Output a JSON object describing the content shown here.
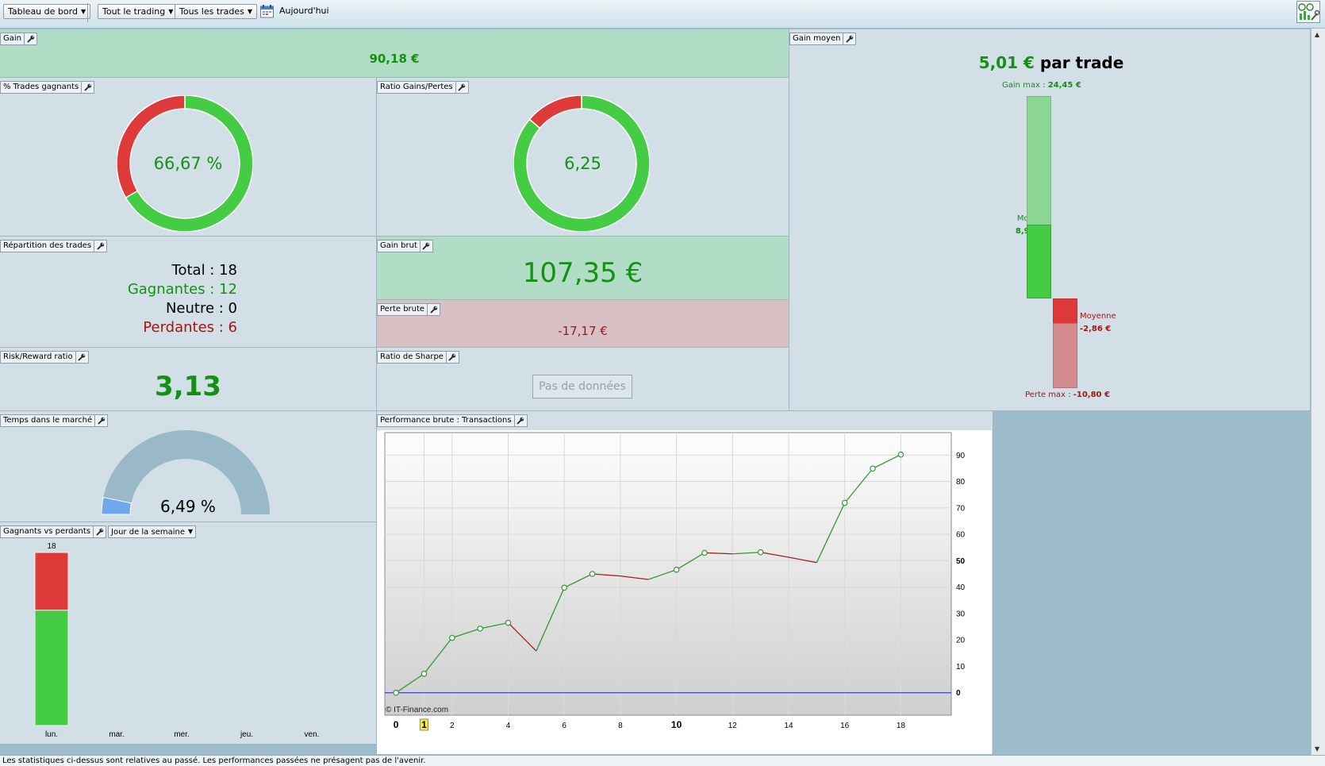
{
  "toolbar": {
    "dashboard_label": "Tableau de bord",
    "trading_filter_label": "Tout le trading",
    "trades_filter_label": "Tous les trades",
    "date_label": "Aujourd'hui"
  },
  "gain": {
    "title": "Gain",
    "value": "90,18 €"
  },
  "win_rate": {
    "title": "% Trades gagnants",
    "value": "66,67 %",
    "fraction": 0.6667
  },
  "ratio_gp": {
    "title": "Ratio Gains/Pertes",
    "value": "6,25",
    "fraction": 0.862
  },
  "repartition": {
    "title": "Répartition des trades",
    "total": "Total : 18",
    "winners": "Gagnantes : 12",
    "neutral": "Neutre : 0",
    "losers": "Perdantes : 6"
  },
  "gross_gain": {
    "title": "Gain brut",
    "value": "107,35 €"
  },
  "gross_loss": {
    "title": "Perte brute",
    "value": "-17,17 €"
  },
  "risk_reward": {
    "title": "Risk/Reward ratio",
    "value": "3,13"
  },
  "sharpe": {
    "title": "Ratio de Sharpe",
    "empty_label": "Pas de données"
  },
  "avg_gain": {
    "title": "Gain moyen",
    "value": "5,01 €",
    "unit": "par trade",
    "max_gain_label": "Gain max :",
    "max_gain_value": "24,45 €",
    "avg_win_label": "Moyen",
    "avg_win_value": "8,95 €",
    "avg_loss_label": "Moyenne",
    "avg_loss_value": "-2,86 €",
    "max_loss_label": "Perte max :",
    "max_loss_value": "-10,80 €"
  },
  "time_in_market": {
    "title": "Temps dans le marché",
    "value": "6,49 %",
    "fraction": 0.0649
  },
  "winners_losers": {
    "title": "Gagnants vs perdants",
    "period_label": "Jour de la semaine",
    "days": [
      "lun.",
      "mar.",
      "mer.",
      "jeu.",
      "ven."
    ],
    "totals": [
      18,
      0,
      0,
      0,
      0
    ],
    "winners": [
      12,
      0,
      0,
      0,
      0
    ],
    "losers": [
      6,
      0,
      0,
      0,
      0
    ],
    "total_label": "18"
  },
  "chart_data": {
    "type": "line",
    "title": "Performance brute : Transactions",
    "watermark": "© IT-Finance.com",
    "x": [
      0,
      1,
      2,
      3,
      4,
      5,
      6,
      7,
      8,
      9,
      10,
      11,
      12,
      13,
      14,
      15,
      16,
      17,
      18
    ],
    "y": [
      0,
      7.2,
      20.8,
      24.3,
      26.5,
      15.8,
      39.8,
      45.0,
      44.2,
      42.9,
      46.6,
      53.0,
      52.6,
      53.2,
      51.3,
      49.3,
      71.9,
      84.9,
      90.18
    ],
    "markers": [
      0,
      1,
      2,
      3,
      4,
      6,
      7,
      10,
      11,
      13,
      16,
      17,
      18
    ],
    "x_ticks": [
      "0",
      "1",
      "2",
      "4",
      "6",
      "8",
      "10",
      "12",
      "14",
      "16",
      "18"
    ],
    "y_ticks": [
      "0",
      "10",
      "20",
      "30",
      "40",
      "50",
      "60",
      "70",
      "80",
      "90"
    ],
    "xlim": [
      -0.4,
      19.8
    ],
    "ylim": [
      -8.5,
      98.5
    ],
    "colors": {
      "up": "#2f9a2f",
      "down": "#a52020",
      "zero": "#2020c0"
    },
    "grid": true
  },
  "footer": {
    "disclaimer": "Les statistiques ci-dessus sont relatives au passé. Les performances passées ne présagent pas de l'avenir."
  },
  "colors": {
    "green": "#44cc44",
    "red": "#de3a3a",
    "gauge": "#9ab9c8",
    "gauge_fill": "#6ea7ee"
  }
}
